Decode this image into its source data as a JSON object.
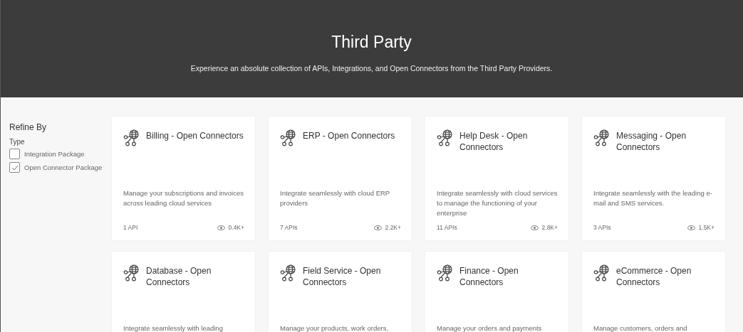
{
  "hero": {
    "title": "Third Party",
    "subtitle": "Experience an absolute collection of APIs, Integrations, and Open Connectors from the Third Party Providers."
  },
  "sidebar": {
    "heading": "Refine By",
    "group": "Type",
    "options": [
      {
        "label": "Integration Package",
        "checked": false
      },
      {
        "label": "Open Connector Package",
        "checked": true
      }
    ]
  },
  "cards": [
    {
      "title": "Billing - Open Connectors",
      "description": "Manage your subscriptions and invoices across leading cloud services",
      "apis": "1 API",
      "views": "0.4K+"
    },
    {
      "title": "ERP - Open Connectors",
      "description": "Integrate seamlessly with cloud ERP providers",
      "apis": "7 APIs",
      "views": "2.2K+"
    },
    {
      "title": "Help Desk - Open Connectors",
      "description": "Integrate seamlessly with cloud services to manage the functioning of your enterprise",
      "apis": "11 APIs",
      "views": "2.8K+"
    },
    {
      "title": "Messaging - Open Connectors",
      "description": "Integrate seamlessly with the leading e-mail and SMS services.",
      "apis": "3 APIs",
      "views": "1.5K+"
    },
    {
      "title": "Database - Open Connectors",
      "description": "Integrate seamlessly with leading"
    },
    {
      "title": "Field Service - Open Connectors",
      "description": "Manage your products, work orders,"
    },
    {
      "title": "Finance - Open Connectors",
      "description": "Manage your orders and payments"
    },
    {
      "title": "eCommerce - Open Connectors",
      "description": "Manage customers, orders and"
    }
  ]
}
